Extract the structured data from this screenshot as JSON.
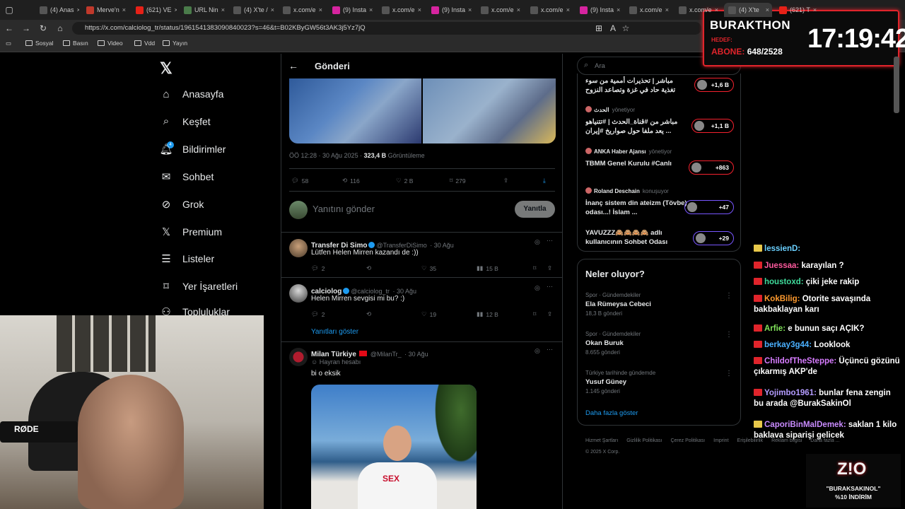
{
  "browser": {
    "tabs": [
      {
        "label": "(4) Anas",
        "color": "#555"
      },
      {
        "label": "Merve'n",
        "color": "#c0392b"
      },
      {
        "label": "(621) VE",
        "color": "#e62117"
      },
      {
        "label": "URL Nin",
        "color": "#4a7b4a"
      },
      {
        "label": "(4) X'te /",
        "color": "#555"
      },
      {
        "label": "x.com/e",
        "color": "#555"
      },
      {
        "label": "(9) Insta",
        "color": "#d6249f"
      },
      {
        "label": "x.com/e",
        "color": "#555"
      },
      {
        "label": "(9) Insta",
        "color": "#d6249f"
      },
      {
        "label": "x.com/e",
        "color": "#555"
      },
      {
        "label": "x.com/e",
        "color": "#555"
      },
      {
        "label": "(9) Insta",
        "color": "#d6249f"
      },
      {
        "label": "x.com/e",
        "color": "#555"
      },
      {
        "label": "x.com/e",
        "color": "#555"
      },
      {
        "label": "(4) X'te",
        "color": "#555"
      },
      {
        "label": "(621) T",
        "color": "#e62117"
      }
    ],
    "url": "https://x.com/calciolog_tr/status/1961541383090840023?s=46&t=B02KByGW56t3AK3j5Yz7jQ",
    "bookmarks": [
      "Sosyal",
      "Basın",
      "Video",
      "Vdd",
      "Yayın"
    ]
  },
  "nav": {
    "items": [
      "Anasayfa",
      "Keşfet",
      "Bildirimler",
      "Sohbet",
      "Grok",
      "Premium",
      "Listeler",
      "Yer İşaretleri",
      "Topluluklar"
    ],
    "notif_badge": "4"
  },
  "post": {
    "header_title": "Gönderi",
    "meta_time": "ÖÖ 12:28 · 30 Ağu 2025 · ",
    "meta_views": "323,4 B",
    "meta_views_label": " Görüntüleme",
    "replies": "58",
    "reposts": "116",
    "likes": "2 B",
    "bookmarks": "279",
    "reply_placeholder": "Yanıtını gönder",
    "reply_button": "Yanıtla"
  },
  "replies": [
    {
      "name": "Transfer Di Simo",
      "handle": "@TransferDiSimo",
      "date": "· 30 Ağu",
      "text": "Lütfen Helen Mirren kazandı de :))",
      "replies": "2",
      "reposts": "",
      "likes": "35",
      "views": "15 B"
    },
    {
      "name": "calciolog",
      "handle": "@calciolog_tr",
      "date": "· 30 Ağu",
      "text": "Helen Mirren sevgisi mi bu? :)",
      "replies": "2",
      "reposts": "",
      "likes": "19",
      "views": "12 B"
    }
  ],
  "show_replies": "Yanıtları göster",
  "reply3": {
    "name": "Milan Türkiye",
    "handle": "@MilanTr_",
    "date": "· 30 Ağu",
    "fan_label": "Hayran hesabı",
    "text": "bi o eksik",
    "shirt_text": "SEX"
  },
  "right": {
    "search_placeholder": "Ara",
    "trends_top": [
      {
        "title": "مباشر | تحذيرات أممية من سوء تغذية حاد في غزة وتصاعد النزوح",
        "count": "+1,6 B"
      },
      {
        "host": "الحدث",
        "role": "yönetiyor",
        "title": "مباشر من #قناة_الحدث | #تتنياهو يعد ملفا حول صواريخ #إيران ...",
        "count": "+1,1 B"
      },
      {
        "host": "ANKA Haber Ajansı",
        "role": "yönetiyor",
        "title": "TBMM Genel Kurulu #Canlı",
        "count": "+863"
      },
      {
        "host": "Roland Deschain",
        "role": "konuşuyor",
        "title": "İnanç sistem din ateizm (Tövbe) odası...! İslam ...",
        "count": "+47"
      },
      {
        "host": "",
        "role": "",
        "title": "YAVUZZZ🙈🙈🙈🙈 adlı kullanıcının Sohbet Odası",
        "count": "+29"
      }
    ],
    "whats_happening_title": "Neler oluyor?",
    "trends": [
      {
        "category": "Spor · Gündemdekiler",
        "name": "Ela Rümeysa Cebeci",
        "posts": "18,3 B gönderi"
      },
      {
        "category": "Spor · Gündemdekiler",
        "name": "Okan Buruk",
        "posts": "8.655 gönderi"
      },
      {
        "category": "Türkiye tarihinde gündemde",
        "name": "Yusuf Güney",
        "posts": "1.145 gönderi"
      }
    ],
    "show_more": "Daha fazla göster",
    "footer_links": [
      "Hizmet Şartları",
      "Gizlilik Politikası",
      "Çerez Politikası",
      "Imprint",
      "Erişilebilirlik",
      "Reklam bilgisi",
      "Daha fazla ..."
    ],
    "copyright": "© 2025 X Corp."
  },
  "overlay": {
    "channel": "BURAKTHON",
    "hedef_label": "HEDEF:",
    "abone_label": "ABONE:",
    "abone_value": "648/2528",
    "clock": "17:19:42",
    "sponsor_code": "\"BURAKSAKINOL\"",
    "sponsor_discount": "%10 İNDİRİM",
    "mic_label": "RØDE"
  },
  "chat": [
    {
      "user": "lessienD:",
      "msg": "",
      "color": "#6ad0ff"
    },
    {
      "user": "Juessaa:",
      "msg": "karayılan ?",
      "color": "#ff5a9e"
    },
    {
      "user": "houstoxd:",
      "msg": "çiki jeke rakip",
      "color": "#3fdc9c"
    },
    {
      "user": "KokBilig:",
      "msg": "Otorite savaşında bakbaklayan karı",
      "color": "#ff9a2e"
    },
    {
      "user": "Arfie:",
      "msg": "e bunun saçı AÇIK?",
      "color": "#80e35a"
    },
    {
      "user": "berkay3g44:",
      "msg": "Looklook",
      "color": "#4bb1ff"
    },
    {
      "user": "ChildofTheSteppe:",
      "msg": "Üçüncü gözünü çıkarmış AKP'de",
      "color": "#d77cff"
    },
    {
      "user": "Yojimbo1961:",
      "msg": "bunlar fena zengin bu arada @BurakSakinOl",
      "color": "#b49cff"
    },
    {
      "user": "CaporiBinMalDemek:",
      "msg": "saklan 1 kilo baklava siparişi gelicek",
      "color": "#c98bff"
    }
  ]
}
